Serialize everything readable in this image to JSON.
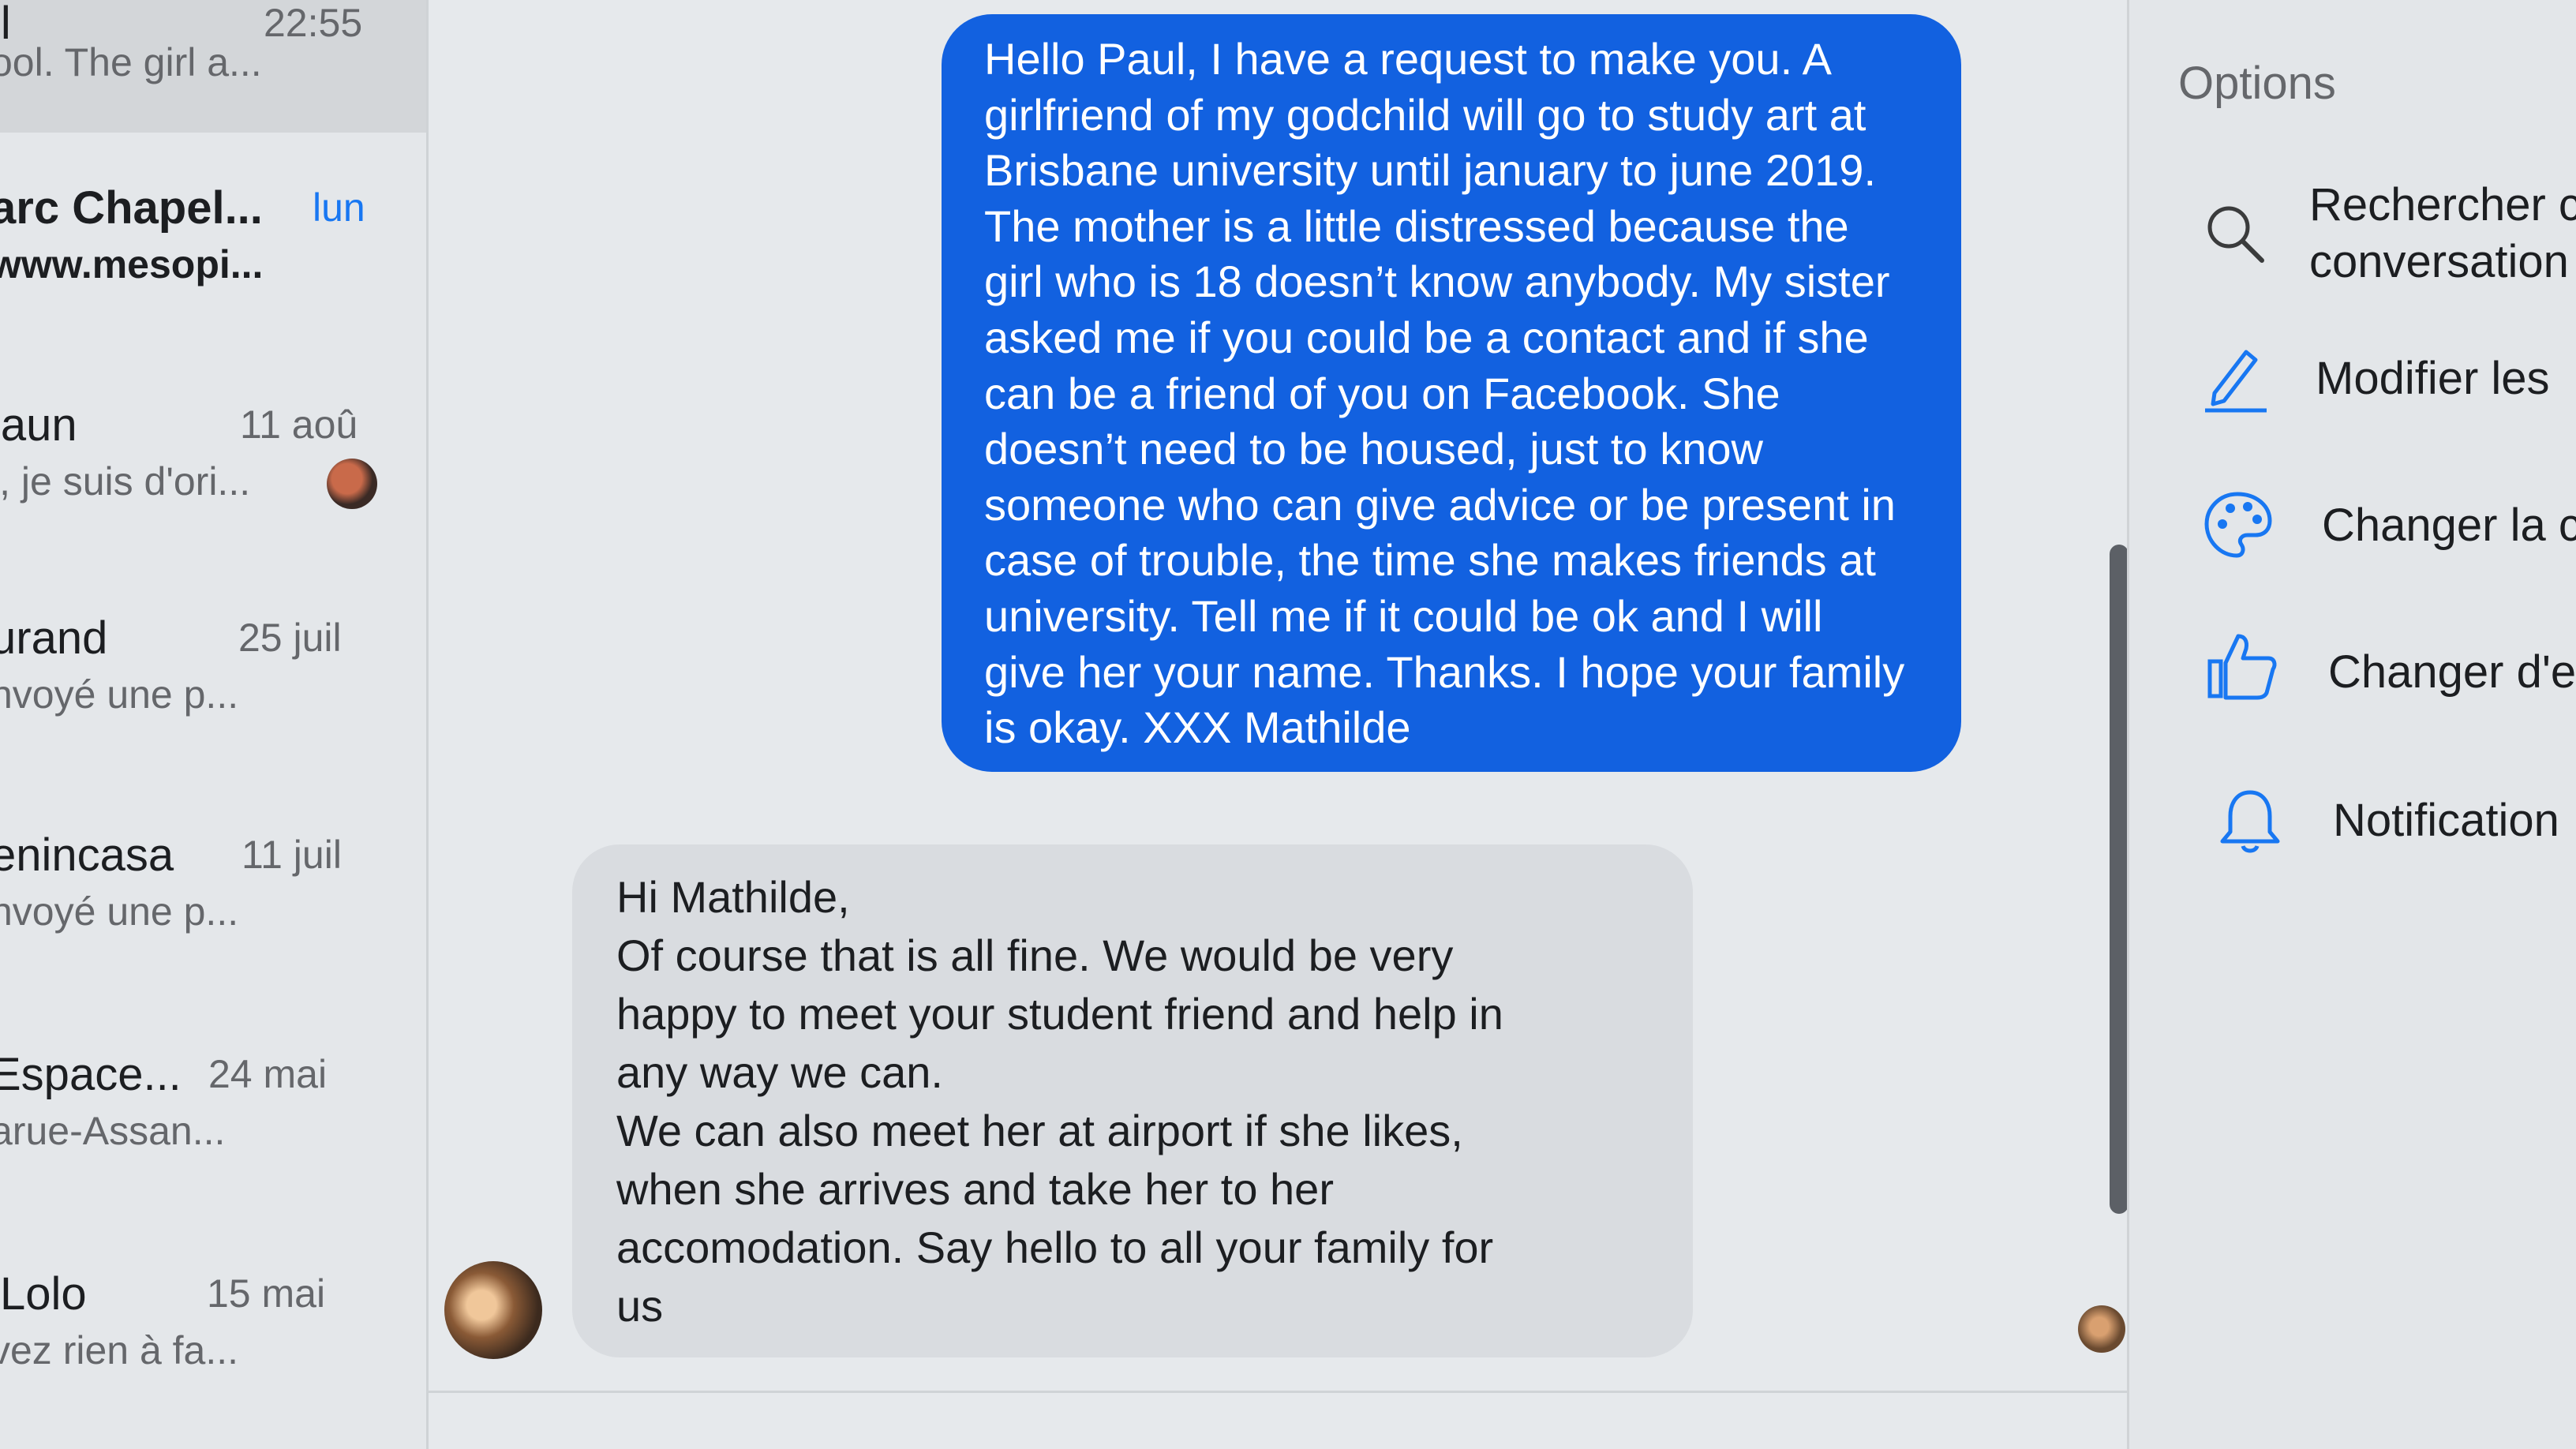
{
  "conversations": [
    {
      "name": "ll",
      "date": "22:55",
      "preview": "ool. The girl a..."
    },
    {
      "name": "arc Chapel...",
      "date": "lun",
      "preview": "www.mesopi..."
    },
    {
      "name": "laun",
      "date": "11 aoû",
      "preview": "i, je suis d'ori..."
    },
    {
      "name": "urand",
      "date": "25 juil",
      "preview": "nvoyé une p..."
    },
    {
      "name": "enincasa",
      "date": "11 juil",
      "preview": "nvoyé une p..."
    },
    {
      "name": "Espace...",
      "date": "24 mai",
      "preview": "arue-Assan..."
    },
    {
      "name": "Lolo",
      "date": "15 mai",
      "preview": "vez rien à fa..."
    }
  ],
  "messages": {
    "outgoing": "Hello Paul, I have a request to make you. A\ngirlfriend of my godchild will go to study art at\nBrisbane university until january to june 2019.\nThe mother is a little distressed because the\ngirl who is 18 doesn’t know anybody. My sister\nasked me if you could be a contact and if she\ncan be a friend of you on Facebook. She\ndoesn’t need to be housed, just to know\nsomeone who can give advice or be present in\ncase of trouble, the time she makes friends at\nuniversity. Tell me if it could be ok and I will\ngive her your name. Thanks. I hope your family\nis okay. XXX Mathilde",
    "incoming": "Hi Mathilde,\nOf course that is all fine. We would be very\nhappy to meet your student friend and help in\nany way we can.\nWe can also meet her at airport if she likes,\nwhen she arrives and take her to her\naccomodation. Say hello to all your family for\nus"
  },
  "options": {
    "title": "Options",
    "items": [
      {
        "label": "Rechercher c\nconversation",
        "icon": "search-icon"
      },
      {
        "label": "Modifier les",
        "icon": "pencil-icon"
      },
      {
        "label": "Changer la c",
        "icon": "palette-icon"
      },
      {
        "label": "Changer d'e",
        "icon": "thumbs-up-icon"
      },
      {
        "label": "Notification",
        "icon": "bell-icon"
      }
    ]
  },
  "colors": {
    "outgoing_bubble": "#1261e0",
    "accent": "#1877f2"
  }
}
